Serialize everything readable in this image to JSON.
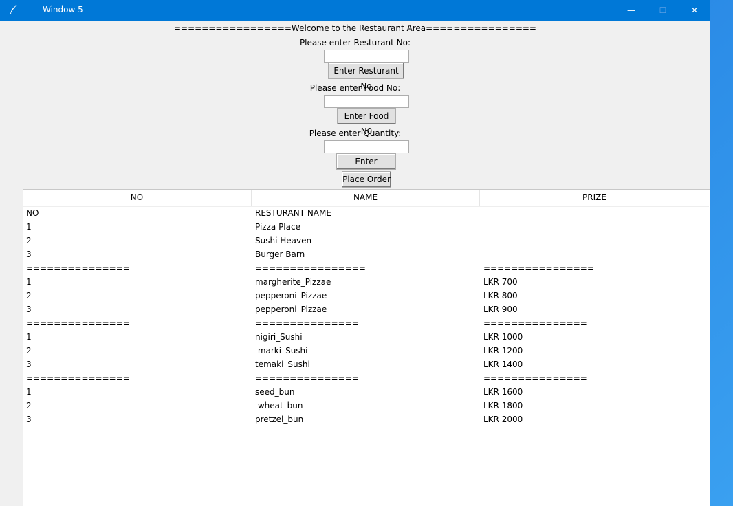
{
  "window": {
    "title": "Window 5",
    "icon": "feather-icon",
    "controls": {
      "minimize": "—",
      "maximize": "☐",
      "close": "✕"
    }
  },
  "form": {
    "welcome": "=================Welcome to the Restaurant Area================",
    "restaurant_label": "Please enter Resturant No:",
    "restaurant_value": "",
    "restaurant_button": "Enter Resturant No",
    "food_label": "Please enter Food No:",
    "food_value": "",
    "food_button": "Enter Food N0",
    "quantity_label": "Please enter Quantity:",
    "quantity_value": "",
    "quantity_button": "Enter Quantity",
    "place_order_button": "Place Order"
  },
  "table": {
    "columns": [
      "NO",
      "NAME",
      "PRIZE"
    ],
    "rows": [
      [
        "NO",
        "RESTURANT NAME",
        ""
      ],
      [
        "1",
        "Pizza Place",
        ""
      ],
      [
        "2",
        "Sushi Heaven",
        ""
      ],
      [
        "3",
        "Burger Barn",
        ""
      ],
      [
        "===============",
        "================",
        "================"
      ],
      [
        "1",
        "margherite_Pizzae",
        "LKR 700"
      ],
      [
        "2",
        "pepperoni_Pizzae",
        "LKR 800"
      ],
      [
        "3",
        "pepperoni_Pizzae",
        "LKR 900"
      ],
      [
        "===============",
        "===============",
        "==============="
      ],
      [
        "1",
        "nigiri_Sushi",
        "LKR 1000"
      ],
      [
        "2",
        " marki_Sushi",
        "LKR 1200"
      ],
      [
        "3",
        "temaki_Sushi",
        "LKR 1400"
      ],
      [
        "===============",
        "===============",
        "==============="
      ],
      [
        "1",
        "seed_bun",
        "LKR 1600"
      ],
      [
        "2",
        " wheat_bun",
        "LKR 1800"
      ],
      [
        "3",
        "pretzel_bun",
        "LKR 2000"
      ]
    ]
  }
}
